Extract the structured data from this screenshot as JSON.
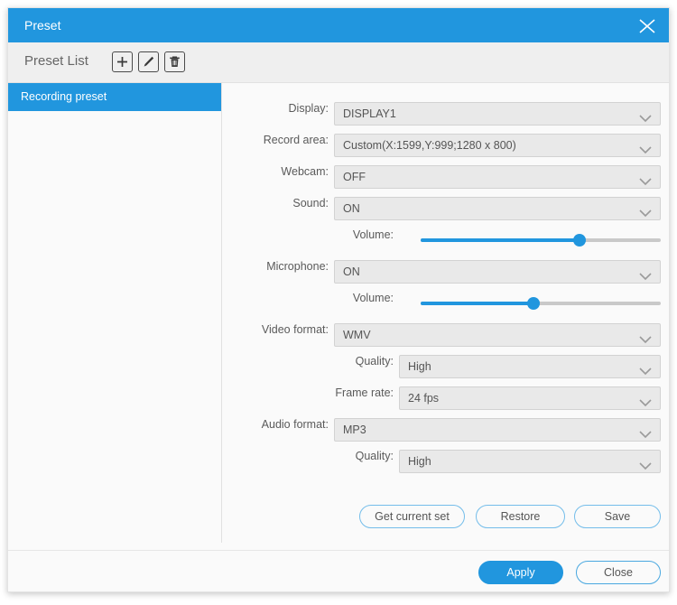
{
  "window": {
    "title": "Preset",
    "close_icon": "close-icon"
  },
  "preset_list": {
    "header_label": "Preset List",
    "tools": [
      {
        "name": "add-preset-button",
        "icon": "plus-icon"
      },
      {
        "name": "edit-preset-button",
        "icon": "pencil-icon"
      },
      {
        "name": "delete-preset-button",
        "icon": "trash-icon"
      }
    ],
    "items": [
      {
        "label": "Recording preset",
        "selected": true
      }
    ]
  },
  "form": {
    "fields": [
      {
        "label": "Display:",
        "value": "DISPLAY1",
        "indent": false
      },
      {
        "label": "Record area:",
        "value": "Custom(X:1599,Y:999;1280 x 800)",
        "indent": false
      },
      {
        "label": "Webcam:",
        "value": "OFF",
        "indent": false
      },
      {
        "label": "Sound:",
        "value": "ON",
        "indent": false
      },
      {
        "label": "Microphone:",
        "value": "ON",
        "indent": false
      },
      {
        "label": "Video format:",
        "value": "WMV",
        "indent": false
      },
      {
        "label": "Quality:",
        "value": "High",
        "indent": true
      },
      {
        "label": "Frame rate:",
        "value": "24 fps",
        "indent": true
      },
      {
        "label": "Audio format:",
        "value": "MP3",
        "indent": false
      },
      {
        "label": "Quality:",
        "value": "High",
        "indent": true
      }
    ],
    "sliders": [
      {
        "label": "Volume:",
        "percent": 66,
        "name": "sound-volume-slider"
      },
      {
        "label": "Volume:",
        "percent": 47,
        "name": "microphone-volume-slider"
      }
    ],
    "actions": [
      {
        "label": "Get current set",
        "name": "get-current-set-button"
      },
      {
        "label": "Restore",
        "name": "restore-button"
      },
      {
        "label": "Save",
        "name": "save-button"
      }
    ]
  },
  "footer": {
    "apply_label": "Apply",
    "close_label": "Close"
  },
  "colors": {
    "accent": "#2196de",
    "panel": "#fafafa",
    "field": "#e9e9e9",
    "header": "#efefef"
  }
}
